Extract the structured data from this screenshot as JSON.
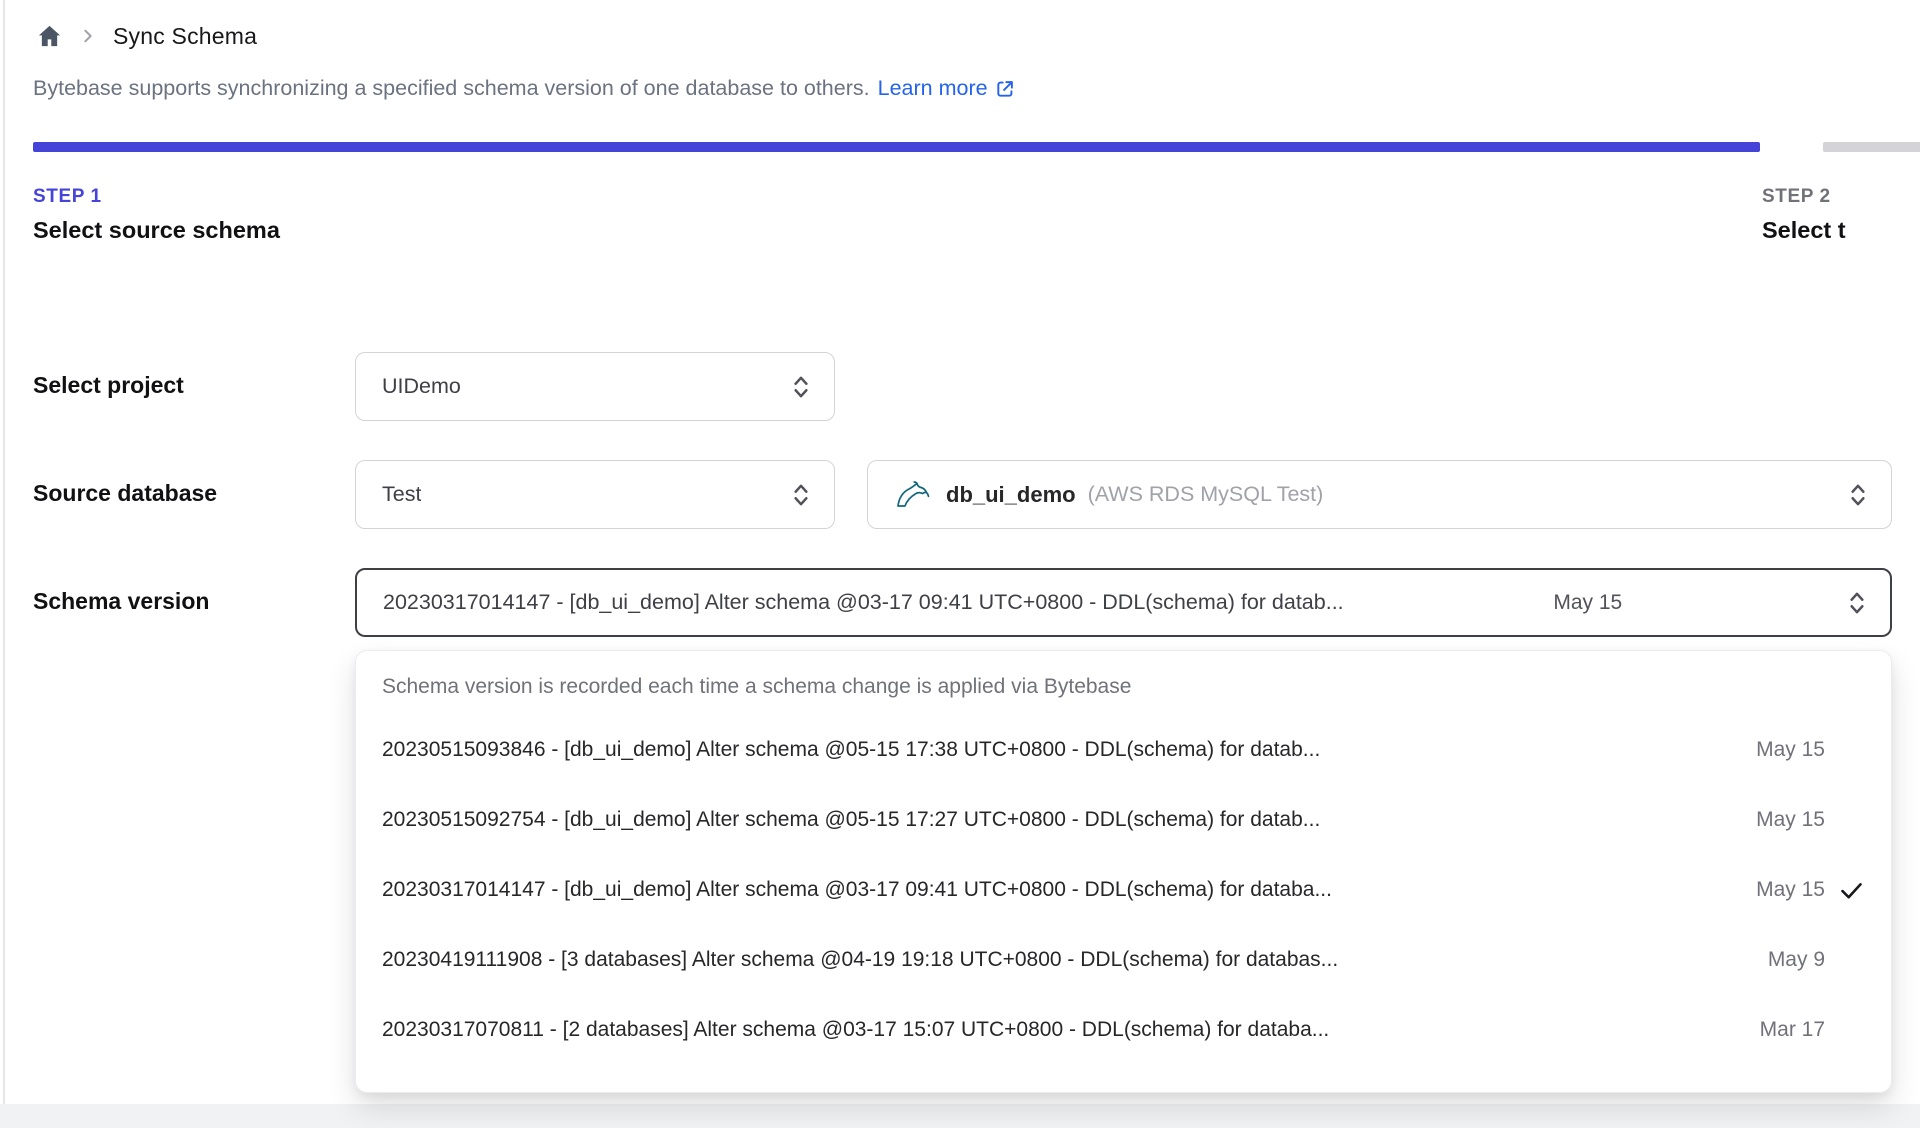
{
  "colors": {
    "accent_indigo": "#4643d9",
    "link_blue": "#2563eb",
    "inactive_bar_gray": "#d4d4d8",
    "focused_border": "#3f3f46",
    "mysql_teal": "#11687d"
  },
  "breadcrumb": {
    "page_title": "Sync Schema"
  },
  "intro": {
    "text": "Bytebase supports synchronizing a specified schema version of one database to others.",
    "link_label": "Learn more"
  },
  "steps": {
    "step1": {
      "label": "STEP 1",
      "title": "Select source schema"
    },
    "step2": {
      "label": "STEP 2",
      "title": "Select t"
    }
  },
  "form": {
    "project": {
      "label": "Select project",
      "value": "UIDemo"
    },
    "source_database": {
      "label": "Source database",
      "environment_value": "Test",
      "database_name": "db_ui_demo",
      "database_detail": "(AWS RDS MySQL Test)"
    },
    "schema_version": {
      "label": "Schema version",
      "value": "20230317014147 - [db_ui_demo] Alter schema @03-17 09:41 UTC+0800 - DDL(schema) for datab...",
      "value_date": "May 15"
    }
  },
  "dropdown": {
    "hint": "Schema version is recorded each time a schema change is applied via Bytebase",
    "options": [
      {
        "text": "20230515093846 - [db_ui_demo] Alter schema @05-15 17:38 UTC+0800 - DDL(schema) for datab...",
        "date": "May 15",
        "selected": false
      },
      {
        "text": "20230515092754 - [db_ui_demo] Alter schema @05-15 17:27 UTC+0800 - DDL(schema) for datab...",
        "date": "May 15",
        "selected": false
      },
      {
        "text": "20230317014147 - [db_ui_demo] Alter schema @03-17 09:41 UTC+0800 - DDL(schema) for databa...",
        "date": "May 15",
        "selected": true
      },
      {
        "text": "20230419111908 - [3 databases] Alter schema @04-19 19:18 UTC+0800 - DDL(schema) for databas...",
        "date": "May 9",
        "selected": false
      },
      {
        "text": "20230317070811 - [2 databases] Alter schema @03-17 15:07 UTC+0800 - DDL(schema) for databa...",
        "date": "Mar 17",
        "selected": false
      }
    ]
  }
}
